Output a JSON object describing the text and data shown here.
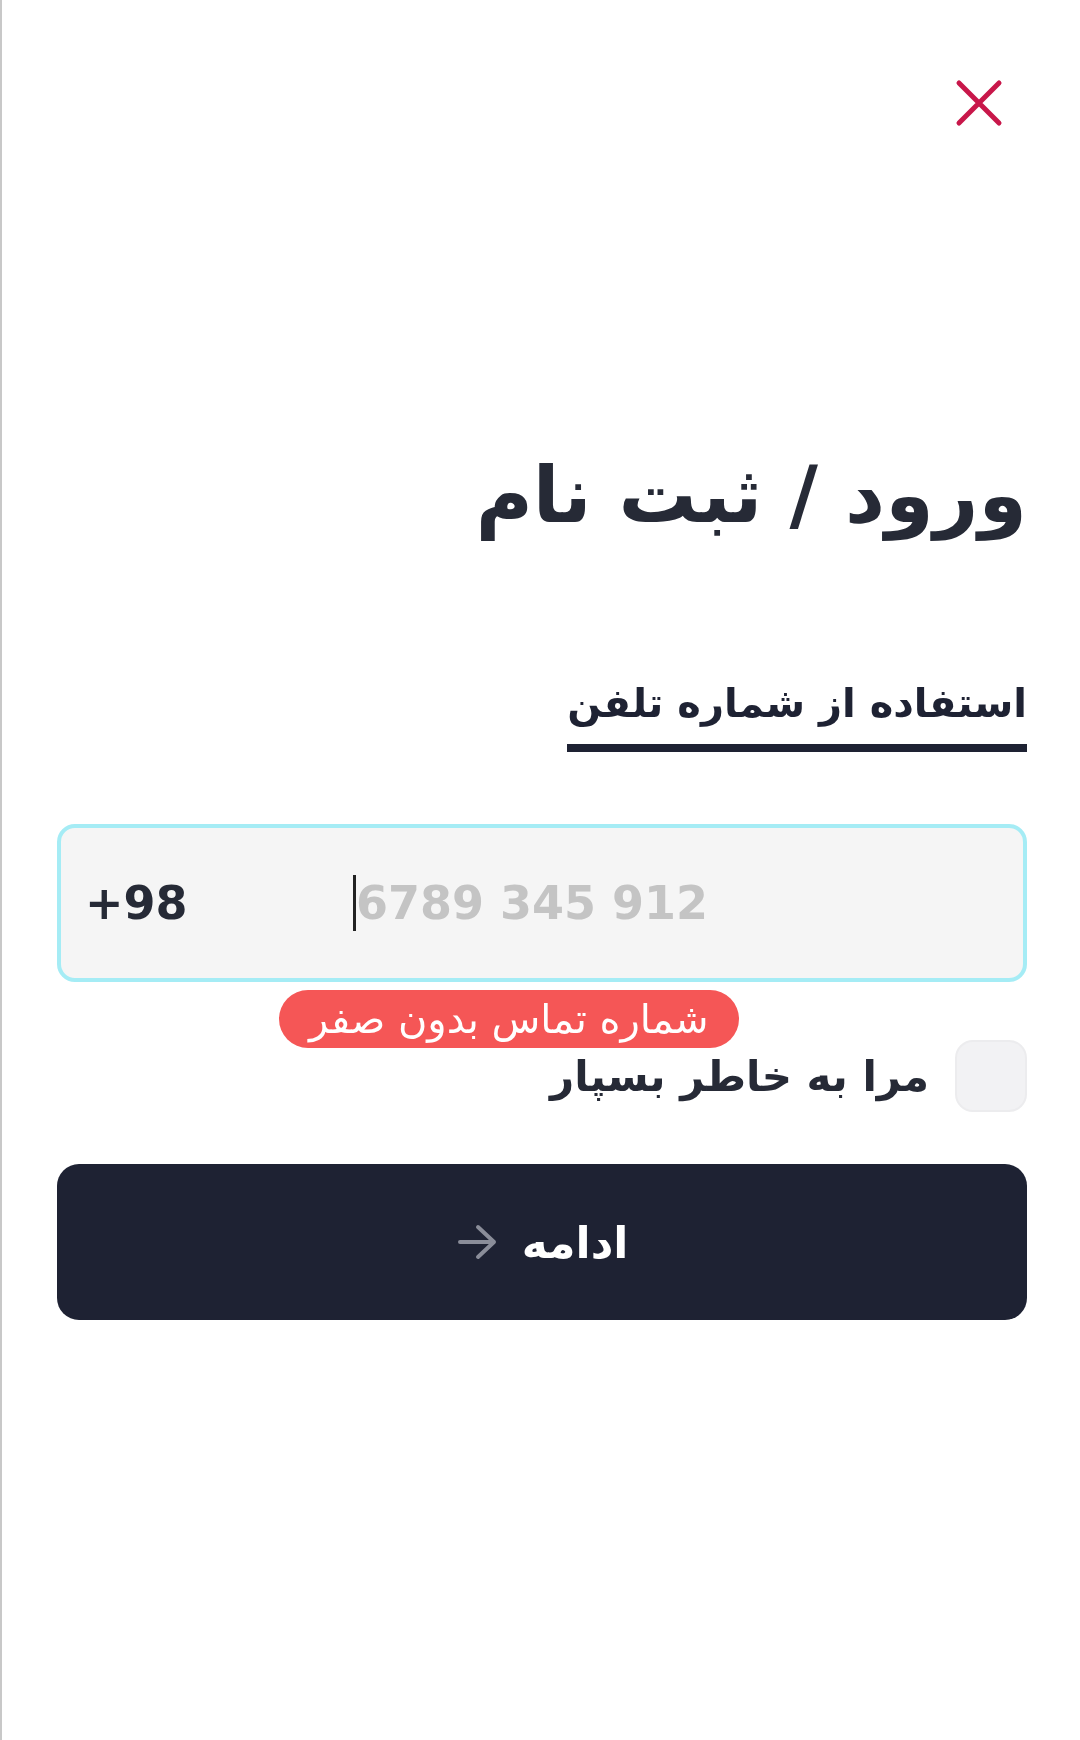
{
  "title": "ورود / ثبت نام",
  "tabs": [
    {
      "label": "استفاده از شماره تلفن",
      "selected": true
    }
  ],
  "phone_field": {
    "country_code": "+98",
    "placeholder": "6789 345 912",
    "focused": true
  },
  "hint": "شماره تماس بدون صفر",
  "remember_me": {
    "label": "مرا به خاطر بسپار",
    "checked": false
  },
  "continue_button": {
    "label": "ادامه"
  }
}
